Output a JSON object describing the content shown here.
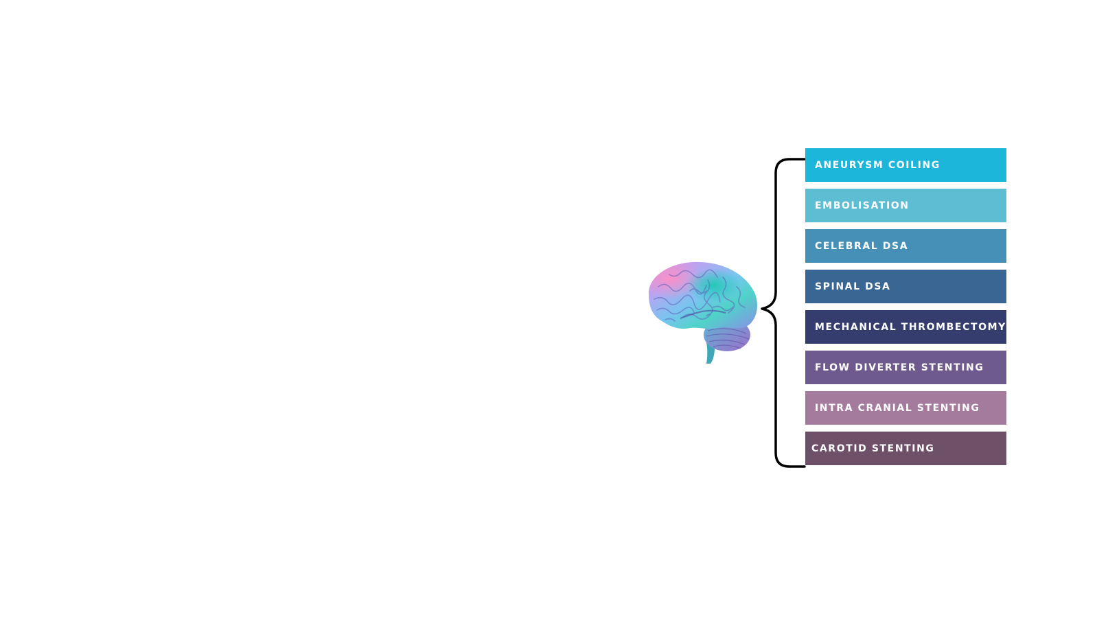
{
  "diagram": {
    "image": {
      "icon": "brain-illustration"
    },
    "connector": {
      "color": "#000000",
      "shape": "curly-brace"
    },
    "procedures": [
      {
        "label": "ANEURYSM COILING",
        "color": "#1bb6d9"
      },
      {
        "label": "EMBOLISATION",
        "color": "#5cbdd3"
      },
      {
        "label": "CELEBRAL DSA",
        "color": "#4690b7"
      },
      {
        "label": "SPINAL DSA",
        "color": "#3a6694"
      },
      {
        "label": "MECHANICAL THROMBECTOMY",
        "color": "#343d6e"
      },
      {
        "label": "FLOW DIVERTER STENTING",
        "color": "#6e5a8c"
      },
      {
        "label": "INTRA CRANIAL STENTING",
        "color": "#a47a9d"
      },
      {
        "label": "CAROTID STENTING",
        "color": "#6e5069"
      }
    ]
  }
}
